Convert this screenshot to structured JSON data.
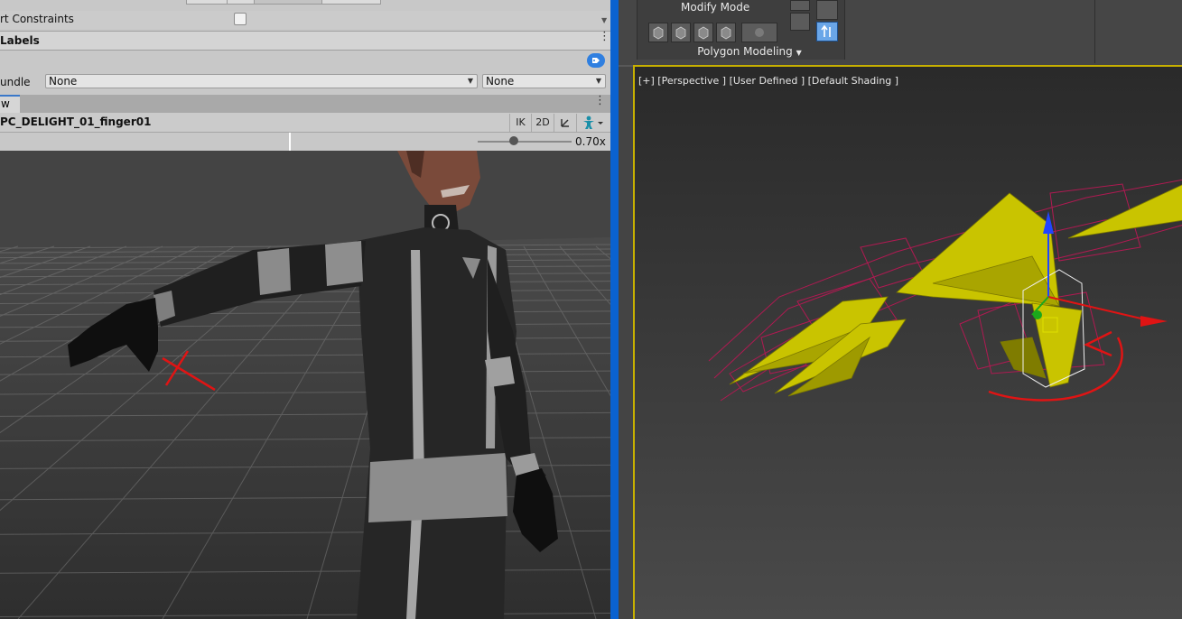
{
  "inspector": {
    "constraints_label": "rt Constraints",
    "labels_header": "Labels",
    "bundle_label": "undle",
    "bundle_value": "None",
    "variant_value": "None"
  },
  "preview": {
    "tab_label": "w",
    "object_name": "PC_DELIGHT_01_finger01",
    "ik_label": "IK",
    "mode_2d_label": "2D",
    "zoom_value": 0.38,
    "zoom_label": "0.70x"
  },
  "max": {
    "modify_mode_label": "Modify Mode",
    "polygon_modeling_label": "Polygon Modeling",
    "viewport_label": "[+] [Perspective ] [User Defined ] [Default Shading ]"
  },
  "colors": {
    "unity_panel": "#c8c8c8",
    "max_dark": "#444444",
    "selection_blue": "#0a62d0",
    "bone_yellow": "#c9c400",
    "annotation_red": "#e01414"
  }
}
